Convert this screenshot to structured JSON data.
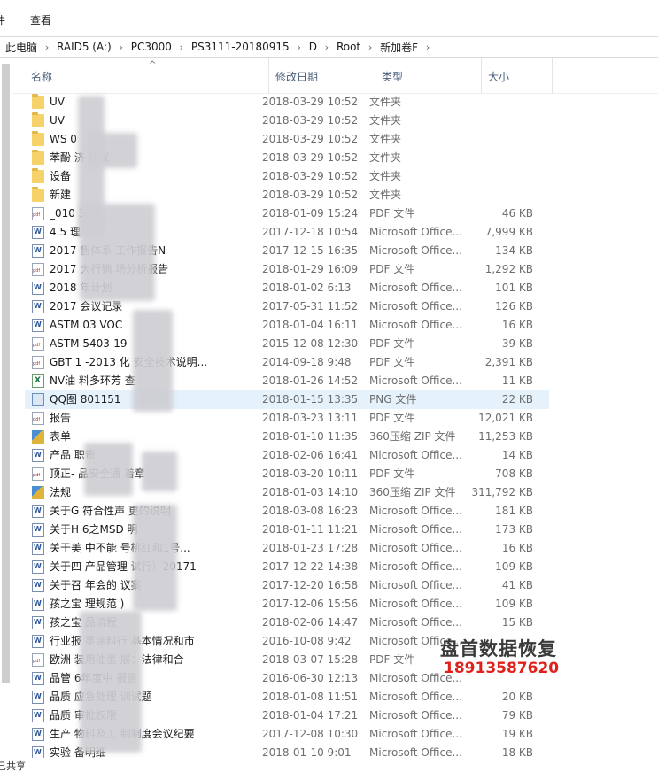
{
  "ribbon": {
    "tab_first": "件",
    "tab_view": "查看"
  },
  "breadcrumb": [
    "此电脑",
    "RAID5 (A:)",
    "PC3000",
    "PS3111-20180915",
    "D",
    "Root",
    "新加卷F"
  ],
  "columns": {
    "name": "名称",
    "date": "修改日期",
    "type": "类型",
    "size": "大小"
  },
  "files": [
    {
      "icon": "folder-icon",
      "name": "UV",
      "date": "2018-03-29 10:52",
      "type": "文件夹",
      "size": ""
    },
    {
      "icon": "folder-icon",
      "name": "UV",
      "date": "2018-03-29 10:52",
      "type": "文件夹",
      "size": ""
    },
    {
      "icon": "folder-icon",
      "name": "WS  0",
      "date": "2018-03-29 10:52",
      "type": "文件夹",
      "size": ""
    },
    {
      "icon": "folder-icon",
      "name": "苯酚      济    建议",
      "date": "2018-03-29 10:52",
      "type": "文件夹",
      "size": ""
    },
    {
      "icon": "folder-icon",
      "name": "设备",
      "date": "2018-03-29 10:52",
      "type": "文件夹",
      "size": ""
    },
    {
      "icon": "folder-icon",
      "name": "新建",
      "date": "2018-03-29 10:52",
      "type": "文件夹",
      "size": ""
    },
    {
      "icon": "pdf-icon",
      "name": "_010    324_",
      "date": "2018-01-09 15:24",
      "type": "PDF 文件",
      "size": "46 KB"
    },
    {
      "icon": "word-icon",
      "name": "4.5      理",
      "date": "2017-12-18 10:54",
      "type": "Microsoft Office...",
      "size": "7,999 KB"
    },
    {
      "icon": "word-icon",
      "name": "2017    售体系    工作报告N",
      "date": "2017-12-15 16:35",
      "type": "Microsoft Office...",
      "size": "134 KB"
    },
    {
      "icon": "pdf-icon",
      "name": "2017    大行销    场分析报告",
      "date": "2018-01-29 16:09",
      "type": "PDF 文件",
      "size": "1,292 KB"
    },
    {
      "icon": "word-icon",
      "name": "2018    年计划",
      "date": "2018-01-02 6:13",
      "type": "Microsoft Office...",
      "size": "101 KB"
    },
    {
      "icon": "word-icon",
      "name": "2017    会议记录",
      "date": "2017-05-31 11:52",
      "type": "Microsoft Office...",
      "size": "126 KB"
    },
    {
      "icon": "word-icon",
      "name": "ASTM    03 VOC",
      "date": "2018-01-04 16:11",
      "type": "Microsoft Office...",
      "size": "16 KB"
    },
    {
      "icon": "pdf-icon",
      "name": "ASTM    5403-19",
      "date": "2015-12-08 12:30",
      "type": "PDF 文件",
      "size": "39 KB"
    },
    {
      "icon": "pdf-icon",
      "name": "GBT 1    -2013 化    安全技术说明...",
      "date": "2014-09-18 9:48",
      "type": "PDF 文件",
      "size": "2,391 KB"
    },
    {
      "icon": "excel-icon",
      "name": "NV油    料多环芳    查",
      "date": "2018-01-26 14:52",
      "type": "Microsoft Office...",
      "size": "11 KB"
    },
    {
      "icon": "image-icon",
      "name": "QQ图    801151",
      "date": "2018-01-15 13:35",
      "type": "PNG 文件",
      "size": "22 KB"
    },
    {
      "icon": "pdf-icon",
      "name": "报告",
      "date": "2018-03-23 13:11",
      "type": "PDF 文件",
      "size": "12,021 KB"
    },
    {
      "icon": "zip-icon",
      "name": "表单",
      "date": "2018-01-10 11:35",
      "type": "360压缩 ZIP 文件",
      "size": "11,253 KB"
    },
    {
      "icon": "word-icon",
      "name": "产品    职责",
      "date": "2018-02-06 16:41",
      "type": "Microsoft Office...",
      "size": "14 KB"
    },
    {
      "icon": "pdf-icon",
      "name": "顶正-    品安全通    着章",
      "date": "2018-03-20 10:11",
      "type": "PDF 文件",
      "size": "708 KB"
    },
    {
      "icon": "zip-icon",
      "name": "法规",
      "date": "2018-01-03 14:10",
      "type": "360压缩 ZIP 文件",
      "size": "311,792 KB"
    },
    {
      "icon": "word-icon",
      "name": "关于G    符合性声    更的说明",
      "date": "2018-03-08 16:23",
      "type": "Microsoft Office...",
      "size": "181 KB"
    },
    {
      "icon": "word-icon",
      "name": "关于H    6之MSD    明",
      "date": "2018-01-11 11:21",
      "type": "Microsoft Office...",
      "size": "173 KB"
    },
    {
      "icon": "word-icon",
      "name": "关于美    中不能    号桃红和1号...",
      "date": "2018-01-23 17:28",
      "type": "Microsoft Office...",
      "size": "16 KB"
    },
    {
      "icon": "word-icon",
      "name": "关于四    产品管理    试行）20171",
      "date": "2017-12-22 14:38",
      "type": "Microsoft Office...",
      "size": "109 KB"
    },
    {
      "icon": "word-icon",
      "name": "关于召    年会的    议案",
      "date": "2017-12-20 16:58",
      "type": "Microsoft Office...",
      "size": "41 KB"
    },
    {
      "icon": "word-icon",
      "name": "孩之宝    理规范    )",
      "date": "2017-12-06 15:56",
      "type": "Microsoft Office...",
      "size": "109 KB"
    },
    {
      "icon": "word-icon",
      "name": "孩之宝    品流程",
      "date": "2018-02-06 14:47",
      "type": "Microsoft Office...",
      "size": "15 KB"
    },
    {
      "icon": "word-icon",
      "name": "行业报    墨涂料行    基本情况和市",
      "date": "2016-10-08 9:42",
      "type": "Microsoft Office...",
      "size": ""
    },
    {
      "icon": "pdf-icon",
      "name": "欧洲    装用油墨    展：法律和合",
      "date": "2018-03-07 15:28",
      "type": "PDF 文件",
      "size": ""
    },
    {
      "icon": "word-icon",
      "name": "品管    6年度中    报告",
      "date": "2016-06-30 12:13",
      "type": "Microsoft Office...",
      "size": ""
    },
    {
      "icon": "word-icon",
      "name": "品质    应急处理    训试题",
      "date": "2018-01-08 11:51",
      "type": "Microsoft Office...",
      "size": "20 KB"
    },
    {
      "icon": "word-icon",
      "name": "品质    审批权限",
      "date": "2018-01-04 17:21",
      "type": "Microsoft Office...",
      "size": "79 KB"
    },
    {
      "icon": "word-icon",
      "name": "生产    物料及工    制制度会议纪要",
      "date": "2017-12-08 10:30",
      "type": "Microsoft Office...",
      "size": "19 KB"
    },
    {
      "icon": "word-icon",
      "name": "实验    备明细",
      "date": "2018-01-10 9:01",
      "type": "Microsoft Office...",
      "size": "18 KB"
    }
  ],
  "selected_index": 16,
  "watermark": {
    "title": "盘首数据恢复",
    "phone": "18913587620"
  },
  "status": {
    "text": "已共享"
  }
}
